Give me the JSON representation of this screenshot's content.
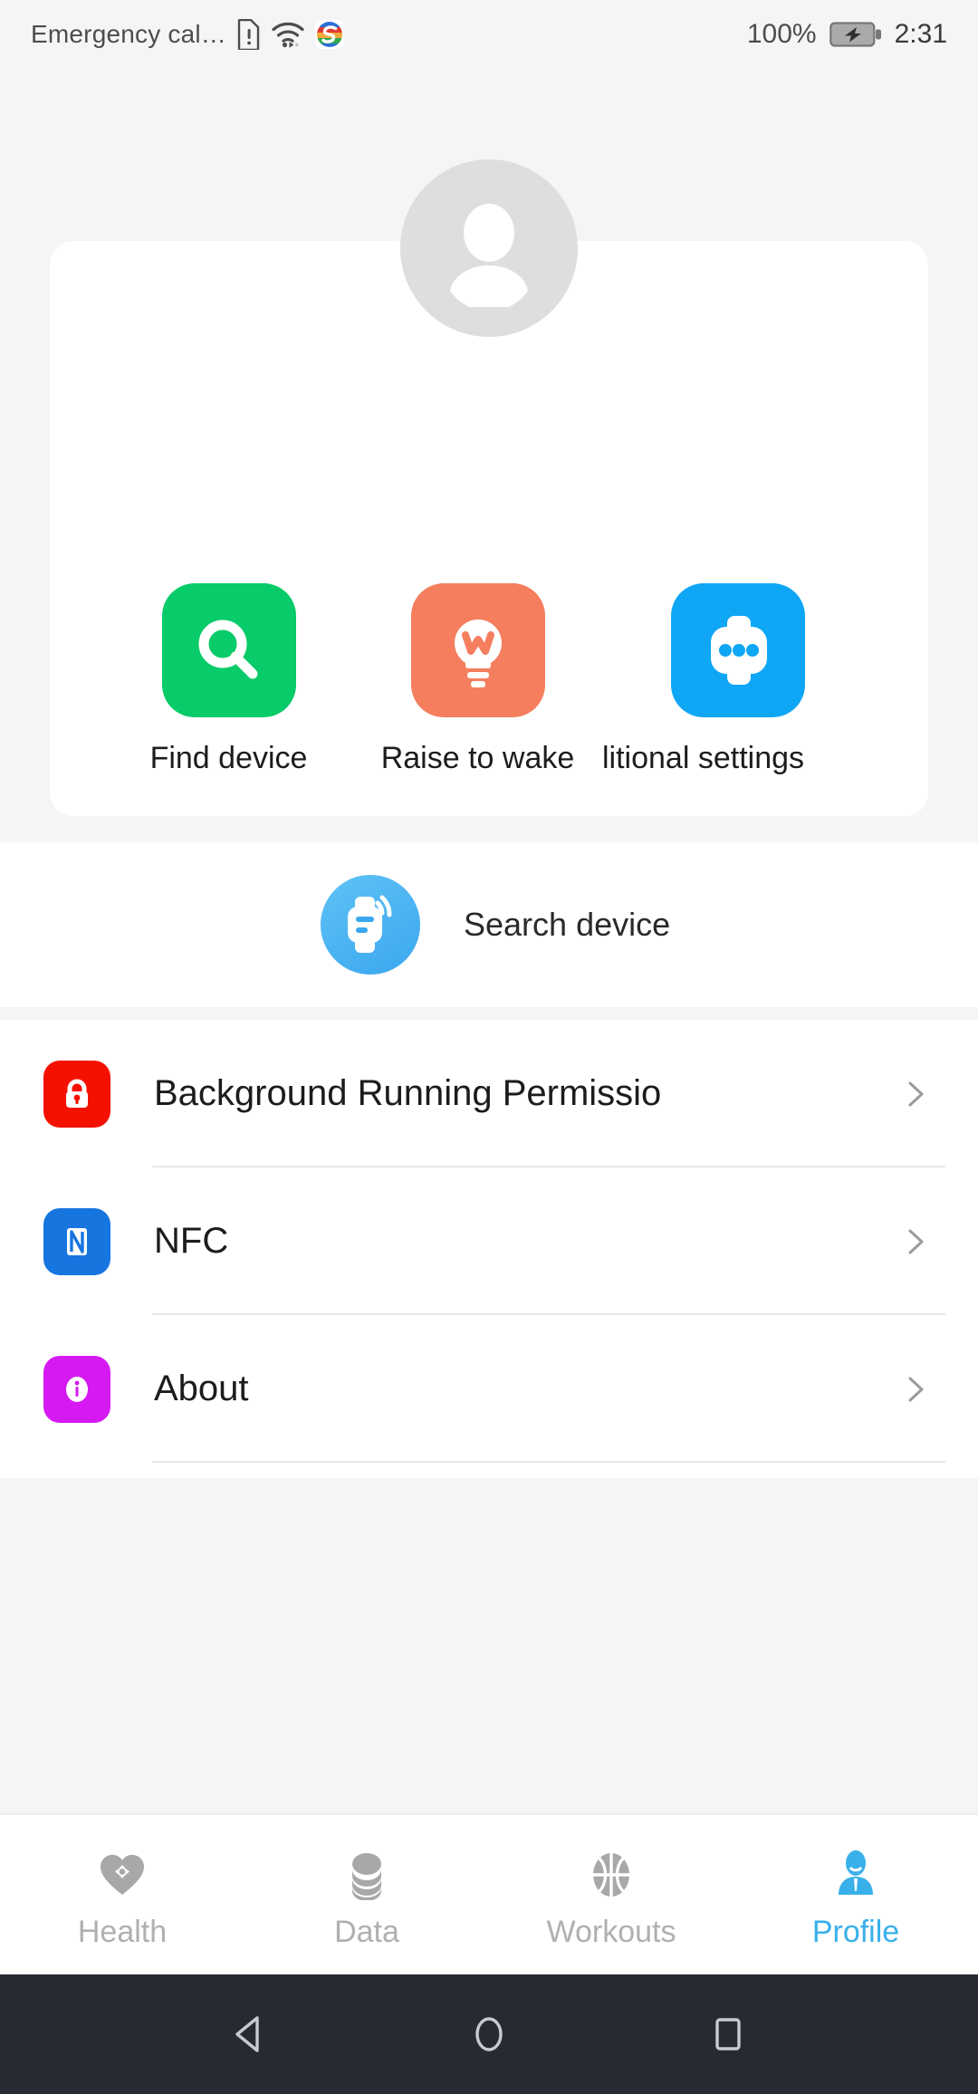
{
  "status_bar": {
    "carrier": "Emergency cal…",
    "battery_percent": "100%",
    "time": "2:31",
    "icons": [
      "sim-alert-icon",
      "wifi-icon",
      "app-badge-icon",
      "battery-charging-icon"
    ]
  },
  "profile": {
    "avatar_icon": "person-avatar-icon"
  },
  "quick_actions": [
    {
      "label": "Find device",
      "icon": "magnifier-icon",
      "color": "#08CB69"
    },
    {
      "label": "Raise to wake",
      "icon": "lightbulb-w-icon",
      "color": "#F47E5E"
    },
    {
      "label": "litional settings",
      "icon": "watch-dots-icon",
      "color": "#0FA6F5"
    }
  ],
  "search_device": {
    "label": "Search device",
    "icon": "watch-signal-icon",
    "color": "#3AA7EF"
  },
  "settings_list": [
    {
      "label": "Background Running Permissio",
      "icon": "lock-icon",
      "color": "#F51100",
      "chevron": "chevron-right-icon"
    },
    {
      "label": "NFC",
      "icon": "nfc-icon",
      "color": "#1775E0",
      "chevron": "chevron-right-icon"
    },
    {
      "label": "About",
      "icon": "info-icon",
      "color": "#D41AF0",
      "chevron": "chevron-right-icon"
    }
  ],
  "bottom_tabs": [
    {
      "label": "Health",
      "icon": "heart-plus-icon",
      "active": false
    },
    {
      "label": "Data",
      "icon": "coins-stack-icon",
      "active": false
    },
    {
      "label": "Workouts",
      "icon": "basketball-icon",
      "active": false
    },
    {
      "label": "Profile",
      "icon": "person-tie-icon",
      "active": true
    }
  ],
  "android_nav": [
    {
      "name": "back-button",
      "icon": "triangle-left-icon"
    },
    {
      "name": "home-button",
      "icon": "circle-icon"
    },
    {
      "name": "recents-button",
      "icon": "square-icon"
    }
  ],
  "theme": {
    "accent": "#39b0ea",
    "page_bg": "#f5f5f5",
    "card_bg": "#ffffff",
    "navbar_bg": "#262b33"
  }
}
